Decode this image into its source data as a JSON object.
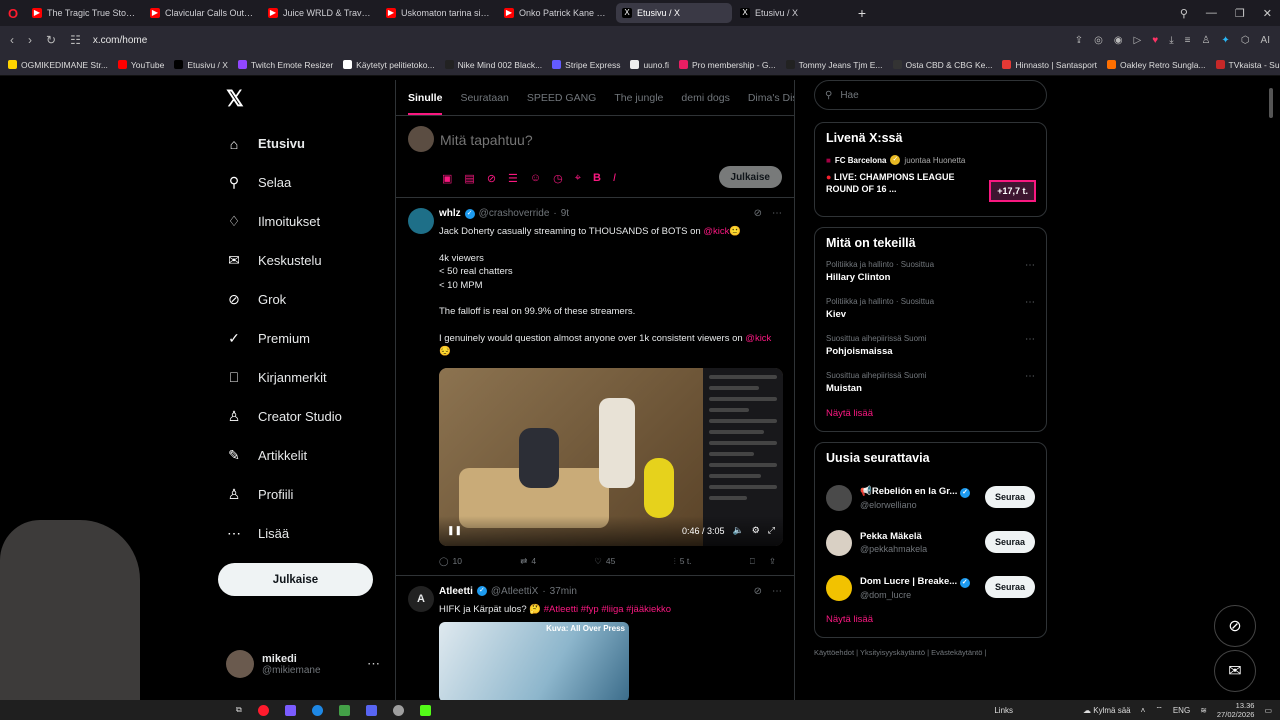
{
  "browser": {
    "tabs": [
      {
        "title": "The Tragic True Story of Ju",
        "color": "#ff0000",
        "active": false
      },
      {
        "title": "Clavicular Calls Out Larry",
        "color": "#ff0000",
        "active": false
      },
      {
        "title": "Juice WRLD & Travis Scott",
        "color": "#ff0000",
        "active": false
      },
      {
        "title": "Uskomaton tarina siinikk",
        "color": "#ff0000",
        "active": false
      },
      {
        "title": "Onko Patrick Kane kaikkie",
        "color": "#ff0000",
        "active": false
      },
      {
        "title": "Etusivu / X",
        "color": "#000000",
        "active": true
      },
      {
        "title": "Etusivu / X",
        "color": "#000000",
        "active": false
      }
    ],
    "url": "x.com/home",
    "ai_label": "AI",
    "bookmarks": [
      {
        "label": "OGMIKEDIMANE Str...",
        "color": "#ffd400"
      },
      {
        "label": "YouTube",
        "color": "#ff0000"
      },
      {
        "label": "Etusivu / X",
        "color": "#000000"
      },
      {
        "label": "Twitch Emote Resizer",
        "color": "#9146ff"
      },
      {
        "label": "Käytetyt pelitietoko...",
        "color": "#ffffff"
      },
      {
        "label": "Nike Mind 002 Black...",
        "color": "#222222"
      },
      {
        "label": "Stripe Express",
        "color": "#635bff"
      },
      {
        "label": "uuno.fi",
        "color": "#eeeeee"
      },
      {
        "label": "Pro membership - G...",
        "color": "#e91e63"
      },
      {
        "label": "Tommy Jeans Tjm E...",
        "color": "#222222"
      },
      {
        "label": "Osta CBD & CBG Ke...",
        "color": "#333333"
      },
      {
        "label": "Hinnasto | Santasport",
        "color": "#e53935"
      },
      {
        "label": "Oakley Retro Sungla...",
        "color": "#ff6f00"
      },
      {
        "label": "TVkaista - Sub Suora",
        "color": "#c62828"
      }
    ]
  },
  "sidebar": {
    "logo": "𝕏",
    "items": [
      {
        "label": "Etusivu",
        "icon": "home-icon",
        "glyph": "⌂"
      },
      {
        "label": "Selaa",
        "icon": "search-icon",
        "glyph": "⚲"
      },
      {
        "label": "Ilmoitukset",
        "icon": "bell-icon",
        "glyph": "♢"
      },
      {
        "label": "Keskustelu",
        "icon": "mail-icon",
        "glyph": "✉"
      },
      {
        "label": "Grok",
        "icon": "grok-icon",
        "glyph": "⊘"
      },
      {
        "label": "Premium",
        "icon": "premium-icon",
        "glyph": "✓"
      },
      {
        "label": "Kirjanmerkit",
        "icon": "bookmark-icon",
        "glyph": "⎕"
      },
      {
        "label": "Creator Studio",
        "icon": "creator-icon",
        "glyph": "♙"
      },
      {
        "label": "Artikkelit",
        "icon": "article-icon",
        "glyph": "✎"
      },
      {
        "label": "Profiili",
        "icon": "profile-icon",
        "glyph": "♙"
      },
      {
        "label": "Lisää",
        "icon": "more-icon",
        "glyph": "⋯"
      }
    ],
    "post_button": "Julkaise",
    "user": {
      "name": "mikedi",
      "handle": "@mikiemane"
    }
  },
  "feed": {
    "tabs": [
      "Sinulle",
      "Seurataan",
      "SPEED GANG",
      "The jungle",
      "demi dogs",
      "Dima's Dist"
    ],
    "composer_placeholder": "Mitä tapahtuu?",
    "composer_post": "Julkaise",
    "tweets": [
      {
        "name": "whlz",
        "handle": "@crashoverride",
        "time": "9t",
        "lines": [
          "Jack Doherty casually streaming to THOUSANDS of BOTS on ",
          "4k viewers",
          "< 50 real chatters",
          "< 10 MPM",
          "The falloff is real on 99.9% of these streamers.",
          "I genuinely would question almost anyone over 1k consistent viewers on "
        ],
        "mention": "@kick",
        "video_time": "0:46 / 3:05",
        "replies": "10",
        "retweets": "4",
        "likes": "45",
        "views": "5 t."
      },
      {
        "name": "Atleetti",
        "handle": "@AtleettiX",
        "time": "37min",
        "text": "HIFK ja Kärpät ulos? ",
        "hashtags": "#Atleetti #fyp #liiga #jääkiekko",
        "image_caption": "Kuva: All Over Press"
      }
    ]
  },
  "right": {
    "search_placeholder": "Hae",
    "live": {
      "title": "Livenä X:ssä",
      "host": "FC Barcelona",
      "host_note": "juontaa Huonetta",
      "event": "LIVE: CHAMPIONS LEAGUE ROUND OF 16 ...",
      "badge": "+17,7 t."
    },
    "trends": {
      "title": "Mitä on tekeillä",
      "items": [
        {
          "cat": "Politiikka ja hallinto · Suosittua",
          "name": "Hillary Clinton"
        },
        {
          "cat": "Politiikka ja hallinto · Suosittua",
          "name": "Kiev"
        },
        {
          "cat": "Suosittua aihepiirissä Suomi",
          "name": "Pohjoismaissa"
        },
        {
          "cat": "Suosittua aihepiirissä Suomi",
          "name": "Muistan"
        }
      ],
      "more": "Näytä lisää"
    },
    "follow": {
      "title": "Uusia seurattavia",
      "items": [
        {
          "name": "📢Rebelión en la Gr...",
          "handle": "@elorwelliano",
          "button": "Seuraa"
        },
        {
          "name": "Pekka Mäkelä",
          "handle": "@pekkahmakela",
          "button": "Seuraa"
        },
        {
          "name": "Dom Lucre | Breake...",
          "handle": "@dom_lucre",
          "button": "Seuraa"
        }
      ],
      "more": "Näytä lisää"
    },
    "footer": "Käyttöehdot | Yksityisyyskäytäntö | Evästekäytäntö |"
  },
  "taskbar": {
    "links": "Links",
    "weather": "Kylmä sää",
    "lang": "ENG",
    "time": "13.36",
    "date": "27/02/2026"
  },
  "colors": {
    "accent": "#f91880",
    "verified": "#1d9bf0"
  }
}
